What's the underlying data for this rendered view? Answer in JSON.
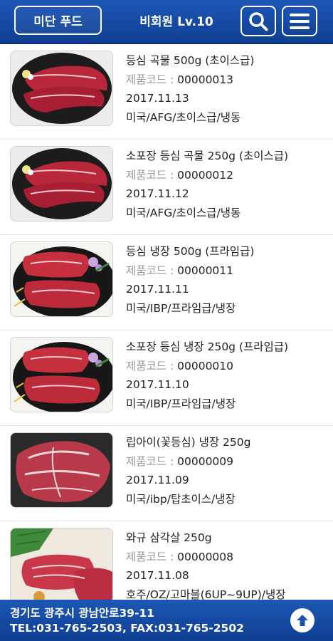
{
  "header": {
    "brand_label": "미단 푸드",
    "user_level": "비회원  Lv.10"
  },
  "products": [
    {
      "title": "등심 곡물 500g (초이스급)",
      "code_label": "제품코드 : ",
      "code": "00000013",
      "date": "2017.11.13",
      "origin": "미국/AFG/초이스급/냉동",
      "image": "grain-ribeye-plate"
    },
    {
      "title": "소포장 등심 곡물 250g (초이스급)",
      "code_label": "제품코드 : ",
      "code": "00000012",
      "date": "2017.11.12",
      "origin": "미국/AFG/초이스급/냉동",
      "image": "grain-ribeye-plate"
    },
    {
      "title": "등심 냉장 500g (프라임급)",
      "code_label": "제품코드 : ",
      "code": "00000011",
      "date": "2017.11.11",
      "origin": "미국/IBP/프라임급/냉장",
      "image": "prime-ribeye-plate"
    },
    {
      "title": "소포장 등심 냉장 250g (프라임급)",
      "code_label": "제품코드 : ",
      "code": "00000010",
      "date": "2017.11.10",
      "origin": "미국/IBP/프라임급/냉장",
      "image": "prime-ribeye-plate"
    },
    {
      "title": "립아이(꽃등심) 냉장 250g",
      "code_label": "제품코드 : ",
      "code": "00000009",
      "date": "2017.11.09",
      "origin": "미국/ibp/탑초이스/냉장",
      "image": "ribeye-steak"
    },
    {
      "title": "와규 삼각살 250g",
      "code_label": "제품코드 : ",
      "code": "00000008",
      "date": "2017.11.08",
      "origin": "호주/OZ/고마블(6UP~9UP)/냉장",
      "image": "wagyu-tri-tip"
    }
  ],
  "footer": {
    "address": "경기도 광주시 광남안로39-11",
    "contact": "TEL:031-765-2503, FAX:031-765-2502"
  },
  "colors": {
    "header_bg": "#1a52ad",
    "footer_bg": "#1a52ad",
    "code_label": "#999999"
  },
  "icons": {
    "search": "search-icon",
    "menu": "hamburger-menu-icon",
    "top": "arrow-up-icon"
  }
}
